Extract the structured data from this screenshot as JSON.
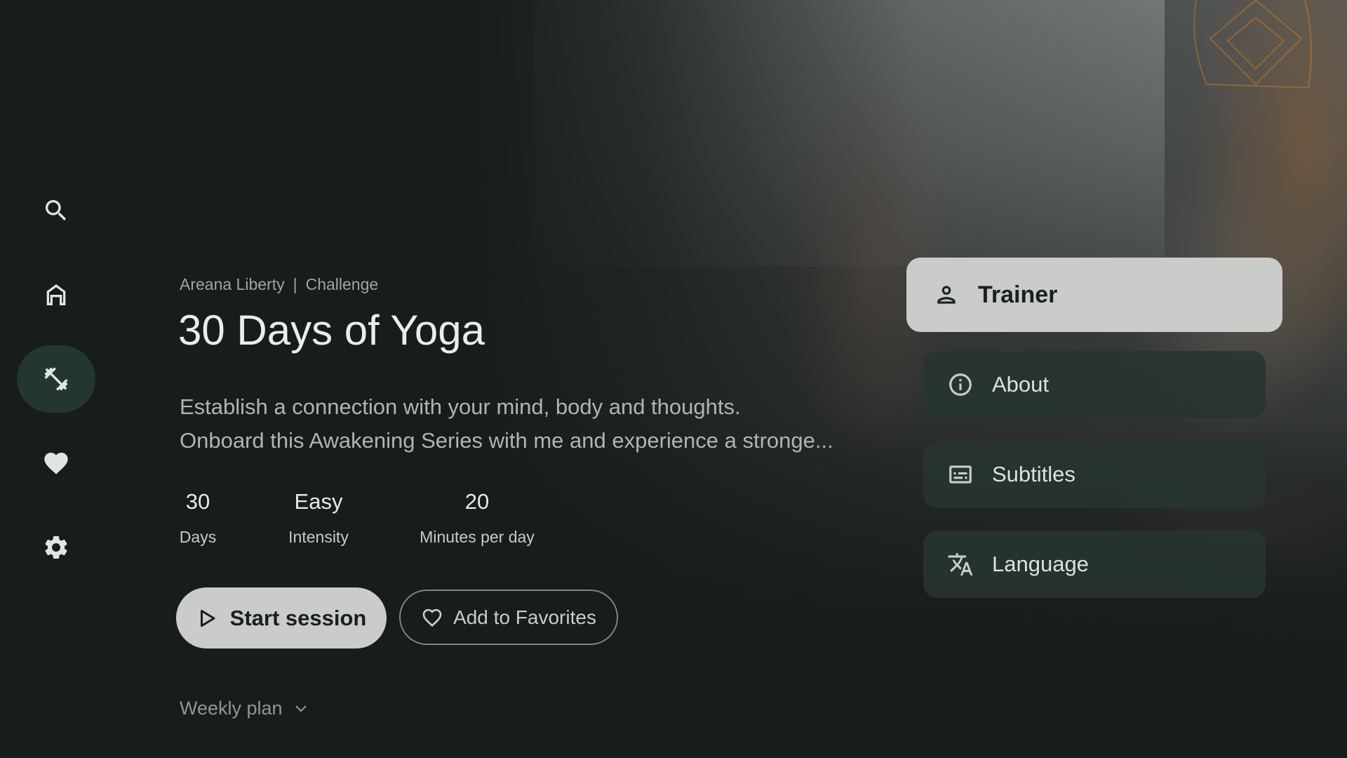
{
  "colors": {
    "background": "#181c1b",
    "nav_active": "#233632",
    "focused_button": "#c9ccc9",
    "menu_item": "#283431"
  },
  "sidebar": {
    "items": [
      {
        "id": "search",
        "icon": "search-icon"
      },
      {
        "id": "home",
        "icon": "home-icon"
      },
      {
        "id": "workouts",
        "icon": "fitness-icon",
        "active": true
      },
      {
        "id": "favorites",
        "icon": "heart-icon"
      },
      {
        "id": "settings",
        "icon": "gear-icon"
      }
    ]
  },
  "program": {
    "trainer": "Areana Liberty",
    "separator": "|",
    "category": "Challenge",
    "title": "30 Days of Yoga",
    "description_line1": "Establish a connection with your mind, body and thoughts.",
    "description_line2": "Onboard this Awakening Series with me and experience a stronge..."
  },
  "stats": [
    {
      "value": "30",
      "label": "Days"
    },
    {
      "value": "Easy",
      "label": "Intensity"
    },
    {
      "value": "20",
      "label": "Minutes per day"
    }
  ],
  "actions": {
    "start_label": "Start session",
    "favorite_label": "Add to Favorites"
  },
  "weekly_plan": {
    "label": "Weekly plan"
  },
  "menu": [
    {
      "label": "Trainer",
      "icon": "person-icon",
      "focused": true
    },
    {
      "label": "About",
      "icon": "info-icon"
    },
    {
      "label": "Subtitles",
      "icon": "subtitles-icon"
    },
    {
      "label": "Language",
      "icon": "translate-icon"
    }
  ]
}
